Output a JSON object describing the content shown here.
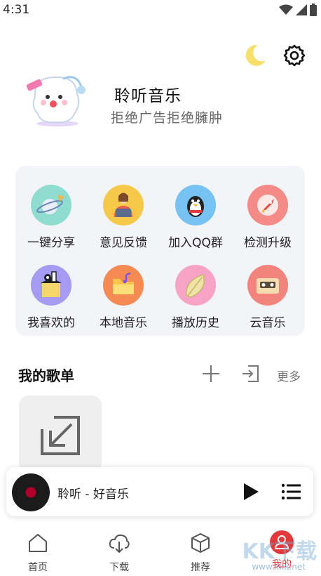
{
  "status": {
    "time": "4:31"
  },
  "profile": {
    "name": "聆听音乐",
    "subtitle": "拒绝广告拒绝臃肿"
  },
  "grid": [
    {
      "label": "一键分享",
      "icon": "share-planet-icon",
      "color": "#8fdcd0"
    },
    {
      "label": "意见反馈",
      "icon": "feedback-person-icon",
      "color": "#f7c94b"
    },
    {
      "label": "加入QQ群",
      "icon": "qq-penguin-icon",
      "color": "#76c2f2"
    },
    {
      "label": "检测升级",
      "icon": "rocket-upgrade-icon",
      "color": "#f58b86"
    },
    {
      "label": "我喜欢的",
      "icon": "favorite-box-icon",
      "color": "#a79af2"
    },
    {
      "label": "本地音乐",
      "icon": "local-folder-icon",
      "color": "#f58a52"
    },
    {
      "label": "播放历史",
      "icon": "history-leaf-icon",
      "color": "#f7a3c6"
    },
    {
      "label": "云音乐",
      "icon": "cloud-cassette-icon",
      "color": "#f3837d"
    }
  ],
  "playlist": {
    "title": "我的歌单",
    "more": "更多"
  },
  "player": {
    "track": "聆听 - 好音乐"
  },
  "tabs": [
    {
      "label": "首页",
      "icon": "home-icon"
    },
    {
      "label": "下载",
      "icon": "cloud-download-icon"
    },
    {
      "label": "推荐",
      "icon": "cube-icon"
    },
    {
      "label": "我的",
      "icon": "profile-icon"
    }
  ],
  "watermark": {
    "text": "KK下载",
    "url": "www.kkx.net"
  },
  "colors": {
    "accent": "#e4393c",
    "card": "#f3f4f8"
  }
}
